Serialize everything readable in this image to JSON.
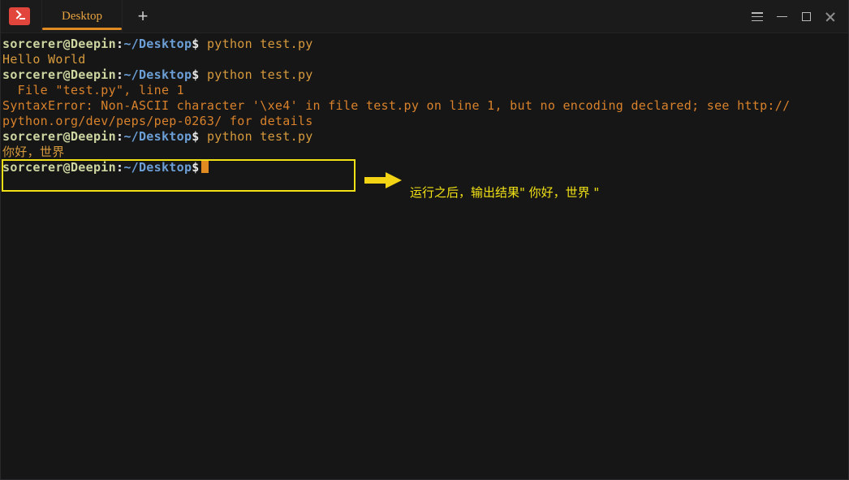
{
  "window": {
    "app_icon": "terminal-icon",
    "tabs": [
      {
        "label": "Desktop",
        "active": true
      }
    ],
    "new_tab_label": "+",
    "controls": {
      "menu": "hamburger-menu-icon",
      "minimize": "minimize-icon",
      "maximize": "maximize-icon",
      "close": "close-icon"
    }
  },
  "terminal": {
    "prompt": {
      "user_host": "sorcerer@Deepin",
      "colon": ":",
      "path": "~/Desktop",
      "dollar": "$"
    },
    "lines": [
      {
        "type": "prompt",
        "command": " python test.py"
      },
      {
        "type": "output",
        "text": "Hello World"
      },
      {
        "type": "prompt",
        "command": " python test.py"
      },
      {
        "type": "output",
        "text": "  File \"test.py\", line 1"
      },
      {
        "type": "output",
        "text": "SyntaxError: Non-ASCII character '\\xe4' in file test.py on line 1, but no encoding declared; see http://"
      },
      {
        "type": "output",
        "text": "python.org/dev/peps/pep-0263/ for details"
      },
      {
        "type": "prompt",
        "command": " python test.py"
      },
      {
        "type": "output",
        "text": "你好，世界"
      },
      {
        "type": "prompt",
        "command": ""
      }
    ],
    "cursor": "block-cursor"
  },
  "annotation": {
    "note_text": "运行之后，输出结果\" 你好，世界 \"",
    "arrow": "right-arrow-icon",
    "highlight_color": "#f2e215",
    "note_color": "#f2e215"
  },
  "colors": {
    "background": "#161617",
    "titlebar": "#1b1b1c",
    "tab_accent": "#e08a22",
    "user_host": "#cdd5a0",
    "path": "#6c9fd6",
    "command": "#d79a3c",
    "app_icon": "#e2453c"
  }
}
